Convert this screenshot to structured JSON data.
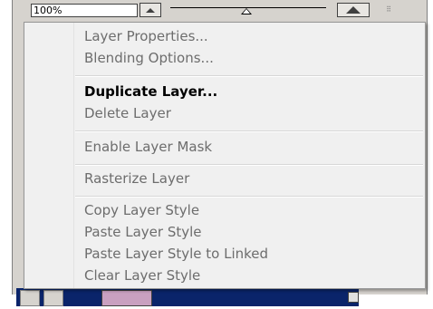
{
  "toolbar": {
    "zoom_value": "100%",
    "zoom_out_icon": "small-mountain-icon",
    "zoom_in_icon": "large-mountain-icon",
    "grip_icon": "resize-grip-icon",
    "grip_glyph": "⠿"
  },
  "context_menu": {
    "groups": [
      [
        {
          "label": "Layer Properties...",
          "enabled": false
        },
        {
          "label": "Blending Options...",
          "enabled": false
        }
      ],
      [
        {
          "label": "Duplicate Layer...",
          "enabled": true
        },
        {
          "label": "Delete Layer",
          "enabled": false
        }
      ],
      [
        {
          "label": "Enable Layer Mask",
          "enabled": false
        }
      ],
      [
        {
          "label": "Rasterize Layer",
          "enabled": false
        }
      ],
      [
        {
          "label": "Copy Layer Style",
          "enabled": false
        },
        {
          "label": "Paste Layer Style",
          "enabled": false
        },
        {
          "label": "Paste Layer Style to Linked",
          "enabled": false
        },
        {
          "label": "Clear Layer Style",
          "enabled": false
        }
      ]
    ]
  },
  "colors": {
    "menu_background": "#f0f0f0",
    "disabled_text": "#6d6d6d",
    "enabled_text": "#000000",
    "selected_layer": "#0a246a"
  }
}
